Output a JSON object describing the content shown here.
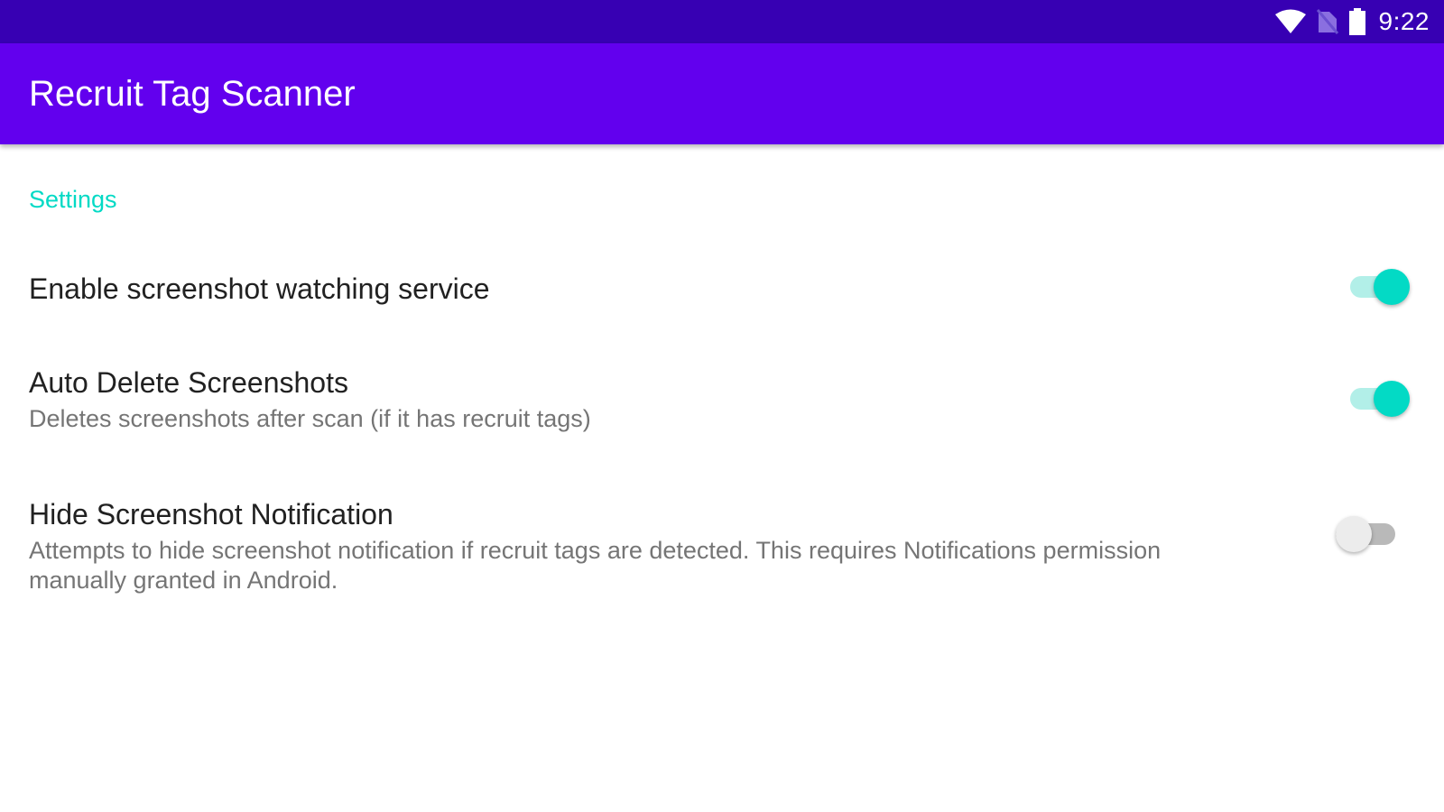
{
  "status_bar": {
    "time": "9:22",
    "icons": [
      "wifi-icon",
      "no-sim-icon",
      "battery-icon"
    ]
  },
  "app_bar": {
    "title": "Recruit Tag Scanner"
  },
  "settings": {
    "category_title": "Settings",
    "items": [
      {
        "title": "Enable screenshot watching service",
        "summary": "",
        "enabled": true
      },
      {
        "title": "Auto Delete Screenshots",
        "summary": "Deletes screenshots after scan (if it has recruit tags)",
        "enabled": true
      },
      {
        "title": "Hide Screenshot Notification",
        "summary": "Attempts to hide screenshot notification if recruit tags are detected. This requires Notifications permission manually granted in Android.",
        "enabled": false
      }
    ]
  },
  "colors": {
    "status_bar": "#3700b3",
    "app_bar": "#6200ee",
    "accent": "#03dac5"
  }
}
